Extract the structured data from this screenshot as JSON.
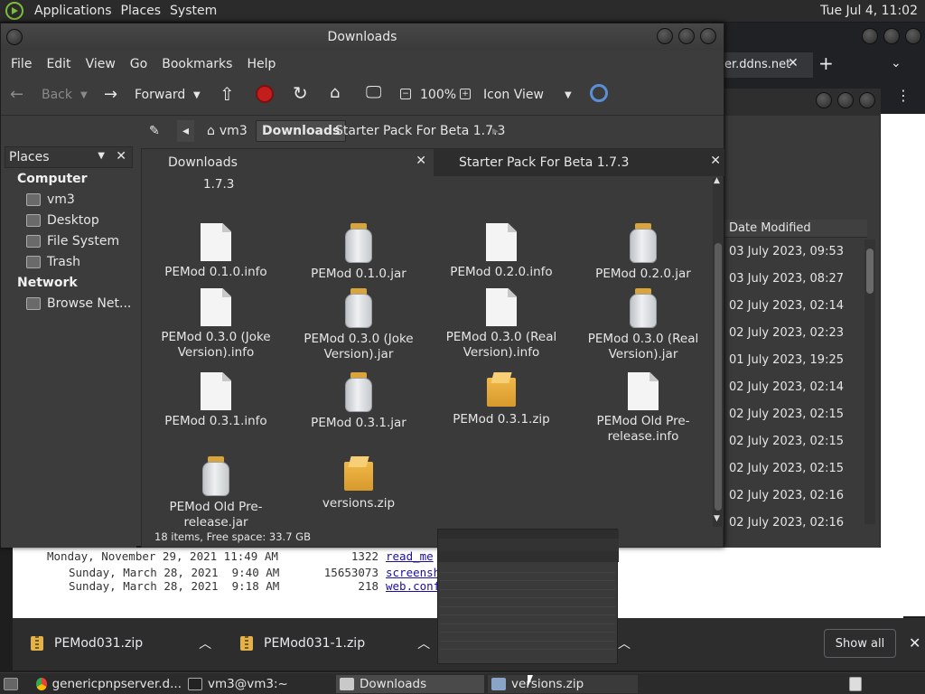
{
  "top_panel": {
    "menus": [
      "Applications",
      "Places",
      "System"
    ],
    "clock": "Tue Jul 4, 11:02"
  },
  "chrome": {
    "tab_label": "er.ddns.net",
    "list_header": "Date Modified",
    "dates": [
      "03 July 2023, 09:53",
      "03 July 2023, 08:27",
      "02 July 2023, 02:14",
      "02 July 2023, 02:23",
      "01 July 2023, 19:25",
      "02 July 2023, 02:14",
      "02 July 2023, 02:15",
      "02 July 2023, 02:15",
      "02 July 2023, 02:15",
      "02 July 2023, 02:16",
      "02 July 2023, 02:16"
    ],
    "terminal_lines": [
      {
        "date": "Monday, November 29, 2021 11:49 AM",
        "size": "1322",
        "link": "read_me"
      },
      {
        "date": "Sunday, March 28, 2021  9:40 AM",
        "size": "15653073",
        "link": "screensh"
      },
      {
        "date": "Sunday, March 28, 2021  9:18 AM",
        "size": "218",
        "link": "web.conf"
      }
    ],
    "downloads": [
      {
        "name": "PEMod031.zip"
      },
      {
        "name": "PEMod031-1.zip"
      }
    ],
    "show_all": "Show all"
  },
  "file_manager": {
    "title": "Downloads",
    "menu": [
      "File",
      "Edit",
      "View",
      "Go",
      "Bookmarks",
      "Help"
    ],
    "toolbar": {
      "back": "Back",
      "forward": "Forward",
      "zoom": "100%",
      "view_mode": "Icon View"
    },
    "path": [
      "vm3",
      "Downloads",
      "Starter Pack For Beta 1.7.3"
    ],
    "sidebar": {
      "header": "Places",
      "groups": [
        {
          "label": "Computer",
          "items": [
            "vm3",
            "Desktop",
            "File System",
            "Trash"
          ]
        },
        {
          "label": "Network",
          "items": [
            "Browse Net..."
          ]
        }
      ]
    },
    "tabs": [
      {
        "label": "Downloads"
      },
      {
        "label": "Starter Pack For Beta 1.7.3"
      }
    ],
    "grid_partial_label": "1.7.3",
    "files": [
      {
        "name": "PEMod 0.1.0.info",
        "type": "doc"
      },
      {
        "name": "PEMod 0.1.0.jar",
        "type": "jar"
      },
      {
        "name": "PEMod 0.2.0.info",
        "type": "doc"
      },
      {
        "name": "PEMod 0.2.0.jar",
        "type": "jar"
      },
      {
        "name": "PEMod 0.3.0 (Joke Version).info",
        "type": "doc"
      },
      {
        "name": "PEMod 0.3.0 (Joke Version).jar",
        "type": "jar"
      },
      {
        "name": "PEMod 0.3.0 (Real Version).info",
        "type": "doc"
      },
      {
        "name": "PEMod 0.3.0 (Real Version).jar",
        "type": "jar"
      },
      {
        "name": "PEMod 0.3.1.info",
        "type": "doc"
      },
      {
        "name": "PEMod 0.3.1.jar",
        "type": "jar"
      },
      {
        "name": "PEMod 0.3.1.zip",
        "type": "zip"
      },
      {
        "name": "PEMod Old Pre-release.info",
        "type": "doc"
      },
      {
        "name": "PEMod Old Pre-release.jar",
        "type": "jar"
      },
      {
        "name": "versions.zip",
        "type": "zip"
      }
    ],
    "status": "18 items, Free space: 33.7 GB"
  },
  "taskbar": {
    "tasks": [
      {
        "label": "genericpnpserver.d...",
        "icon": "chrome-icon"
      },
      {
        "label": "vm3@vm3:~",
        "icon": "terminal-icon"
      },
      {
        "label": "Downloads",
        "icon": "folder-icon"
      },
      {
        "label": "versions.zip",
        "icon": "archive-icon"
      }
    ]
  }
}
